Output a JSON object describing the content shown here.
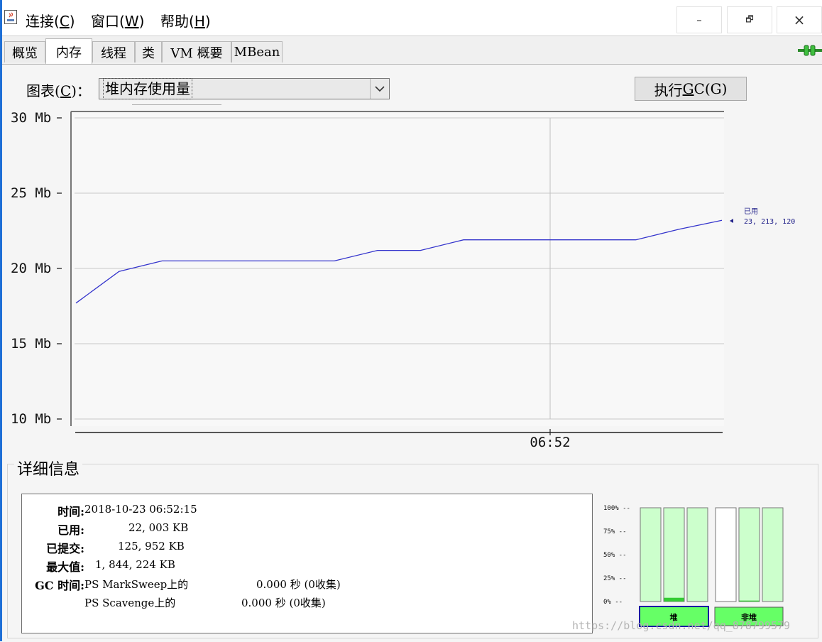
{
  "menubar": {
    "items": [
      {
        "text": "连接(",
        "key": "C",
        "end": ")"
      },
      {
        "text": "窗口(",
        "key": "W",
        "end": ")"
      },
      {
        "text": "帮助(",
        "key": "H",
        "end": ")"
      }
    ],
    "window_controls": {
      "minimize": "–",
      "restore": "🗗",
      "close": "×"
    }
  },
  "tabs": [
    "概览",
    "内存",
    "线程",
    "类",
    "VM 概要",
    "MBean"
  ],
  "active_tab": "内存",
  "toolbar": {
    "chart_label": "图表(",
    "chart_label_key": "C",
    "chart_label_end": ")：",
    "chart_selected": "堆内存使用量",
    "gc_button": "执行 ",
    "gc_button_key": "G",
    "gc_button_end": "C(G)"
  },
  "chart_data": {
    "type": "line",
    "y_ticks": [
      "30 Mb",
      "25 Mb",
      "20 Mb",
      "15 Mb",
      "10 Mb"
    ],
    "ylim": [
      10,
      30
    ],
    "x_tick_labels": [
      "06:52"
    ],
    "series": [
      {
        "name": "已用",
        "color": "#3333cc",
        "points": [
          {
            "t": 0,
            "y": 17.7
          },
          {
            "t": 1,
            "y": 19.8
          },
          {
            "t": 2,
            "y": 20.5
          },
          {
            "t": 3,
            "y": 20.5
          },
          {
            "t": 4,
            "y": 20.5
          },
          {
            "t": 5,
            "y": 20.5
          },
          {
            "t": 6,
            "y": 20.5
          },
          {
            "t": 7,
            "y": 21.2
          },
          {
            "t": 8,
            "y": 21.2
          },
          {
            "t": 9,
            "y": 21.9
          },
          {
            "t": 10,
            "y": 21.9
          },
          {
            "t": 11,
            "y": 21.9
          },
          {
            "t": 12,
            "y": 21.9
          },
          {
            "t": 13,
            "y": 21.9
          },
          {
            "t": 14,
            "y": 22.6
          },
          {
            "t": 15,
            "y": 23.2
          }
        ]
      }
    ],
    "current_label": "已用",
    "current_value": "23, 213, 120"
  },
  "details": {
    "title": "详细信息",
    "rows": [
      {
        "label": "时间:",
        "value": "2018-10-23 06:52:15"
      },
      {
        "label": "已用:",
        "value": "22, 003 KB"
      },
      {
        "label": "已提交:",
        "value": "125, 952 KB"
      },
      {
        "label": "最大值:",
        "value": "1, 844, 224 KB"
      }
    ],
    "gc_label": "GC 时间:",
    "gc_rows": [
      {
        "name": "PS MarkSweep上的",
        "time": "0.000 秒 (0收集)"
      },
      {
        "name": "PS Scavenge上的",
        "time": "0.000 秒 (0收集)"
      }
    ]
  },
  "pool_bars": {
    "ticks": [
      "100% --",
      "75% --",
      "50% --",
      "25% --",
      "0% --"
    ],
    "heap_label": "堆",
    "nonheap_label": "非堆",
    "heap_levels": [
      0.0,
      0.04,
      0.0
    ],
    "nonheap_levels": [
      0.0,
      0.01,
      0.0
    ],
    "bar_colors": {
      "fill": "#ccffcc",
      "used": "#33cc33",
      "label_bg": "#66ff66",
      "empty": "#ffffff"
    }
  },
  "watermark": "https://blog.csdn.net/qq_878799579"
}
